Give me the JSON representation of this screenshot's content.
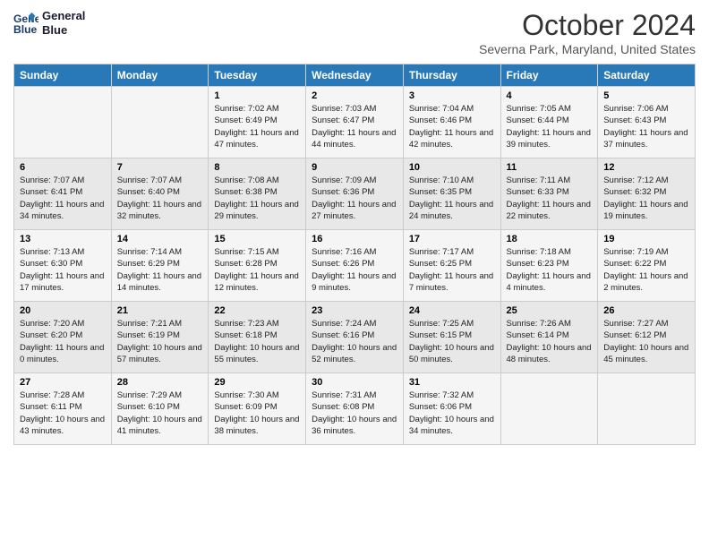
{
  "header": {
    "logo_line1": "General",
    "logo_line2": "Blue",
    "month_year": "October 2024",
    "location": "Severna Park, Maryland, United States"
  },
  "weekdays": [
    "Sunday",
    "Monday",
    "Tuesday",
    "Wednesday",
    "Thursday",
    "Friday",
    "Saturday"
  ],
  "weeks": [
    [
      {
        "day": "",
        "sunrise": "",
        "sunset": "",
        "daylight": ""
      },
      {
        "day": "",
        "sunrise": "",
        "sunset": "",
        "daylight": ""
      },
      {
        "day": "1",
        "sunrise": "Sunrise: 7:02 AM",
        "sunset": "Sunset: 6:49 PM",
        "daylight": "Daylight: 11 hours and 47 minutes."
      },
      {
        "day": "2",
        "sunrise": "Sunrise: 7:03 AM",
        "sunset": "Sunset: 6:47 PM",
        "daylight": "Daylight: 11 hours and 44 minutes."
      },
      {
        "day": "3",
        "sunrise": "Sunrise: 7:04 AM",
        "sunset": "Sunset: 6:46 PM",
        "daylight": "Daylight: 11 hours and 42 minutes."
      },
      {
        "day": "4",
        "sunrise": "Sunrise: 7:05 AM",
        "sunset": "Sunset: 6:44 PM",
        "daylight": "Daylight: 11 hours and 39 minutes."
      },
      {
        "day": "5",
        "sunrise": "Sunrise: 7:06 AM",
        "sunset": "Sunset: 6:43 PM",
        "daylight": "Daylight: 11 hours and 37 minutes."
      }
    ],
    [
      {
        "day": "6",
        "sunrise": "Sunrise: 7:07 AM",
        "sunset": "Sunset: 6:41 PM",
        "daylight": "Daylight: 11 hours and 34 minutes."
      },
      {
        "day": "7",
        "sunrise": "Sunrise: 7:07 AM",
        "sunset": "Sunset: 6:40 PM",
        "daylight": "Daylight: 11 hours and 32 minutes."
      },
      {
        "day": "8",
        "sunrise": "Sunrise: 7:08 AM",
        "sunset": "Sunset: 6:38 PM",
        "daylight": "Daylight: 11 hours and 29 minutes."
      },
      {
        "day": "9",
        "sunrise": "Sunrise: 7:09 AM",
        "sunset": "Sunset: 6:36 PM",
        "daylight": "Daylight: 11 hours and 27 minutes."
      },
      {
        "day": "10",
        "sunrise": "Sunrise: 7:10 AM",
        "sunset": "Sunset: 6:35 PM",
        "daylight": "Daylight: 11 hours and 24 minutes."
      },
      {
        "day": "11",
        "sunrise": "Sunrise: 7:11 AM",
        "sunset": "Sunset: 6:33 PM",
        "daylight": "Daylight: 11 hours and 22 minutes."
      },
      {
        "day": "12",
        "sunrise": "Sunrise: 7:12 AM",
        "sunset": "Sunset: 6:32 PM",
        "daylight": "Daylight: 11 hours and 19 minutes."
      }
    ],
    [
      {
        "day": "13",
        "sunrise": "Sunrise: 7:13 AM",
        "sunset": "Sunset: 6:30 PM",
        "daylight": "Daylight: 11 hours and 17 minutes."
      },
      {
        "day": "14",
        "sunrise": "Sunrise: 7:14 AM",
        "sunset": "Sunset: 6:29 PM",
        "daylight": "Daylight: 11 hours and 14 minutes."
      },
      {
        "day": "15",
        "sunrise": "Sunrise: 7:15 AM",
        "sunset": "Sunset: 6:28 PM",
        "daylight": "Daylight: 11 hours and 12 minutes."
      },
      {
        "day": "16",
        "sunrise": "Sunrise: 7:16 AM",
        "sunset": "Sunset: 6:26 PM",
        "daylight": "Daylight: 11 hours and 9 minutes."
      },
      {
        "day": "17",
        "sunrise": "Sunrise: 7:17 AM",
        "sunset": "Sunset: 6:25 PM",
        "daylight": "Daylight: 11 hours and 7 minutes."
      },
      {
        "day": "18",
        "sunrise": "Sunrise: 7:18 AM",
        "sunset": "Sunset: 6:23 PM",
        "daylight": "Daylight: 11 hours and 4 minutes."
      },
      {
        "day": "19",
        "sunrise": "Sunrise: 7:19 AM",
        "sunset": "Sunset: 6:22 PM",
        "daylight": "Daylight: 11 hours and 2 minutes."
      }
    ],
    [
      {
        "day": "20",
        "sunrise": "Sunrise: 7:20 AM",
        "sunset": "Sunset: 6:20 PM",
        "daylight": "Daylight: 11 hours and 0 minutes."
      },
      {
        "day": "21",
        "sunrise": "Sunrise: 7:21 AM",
        "sunset": "Sunset: 6:19 PM",
        "daylight": "Daylight: 10 hours and 57 minutes."
      },
      {
        "day": "22",
        "sunrise": "Sunrise: 7:23 AM",
        "sunset": "Sunset: 6:18 PM",
        "daylight": "Daylight: 10 hours and 55 minutes."
      },
      {
        "day": "23",
        "sunrise": "Sunrise: 7:24 AM",
        "sunset": "Sunset: 6:16 PM",
        "daylight": "Daylight: 10 hours and 52 minutes."
      },
      {
        "day": "24",
        "sunrise": "Sunrise: 7:25 AM",
        "sunset": "Sunset: 6:15 PM",
        "daylight": "Daylight: 10 hours and 50 minutes."
      },
      {
        "day": "25",
        "sunrise": "Sunrise: 7:26 AM",
        "sunset": "Sunset: 6:14 PM",
        "daylight": "Daylight: 10 hours and 48 minutes."
      },
      {
        "day": "26",
        "sunrise": "Sunrise: 7:27 AM",
        "sunset": "Sunset: 6:12 PM",
        "daylight": "Daylight: 10 hours and 45 minutes."
      }
    ],
    [
      {
        "day": "27",
        "sunrise": "Sunrise: 7:28 AM",
        "sunset": "Sunset: 6:11 PM",
        "daylight": "Daylight: 10 hours and 43 minutes."
      },
      {
        "day": "28",
        "sunrise": "Sunrise: 7:29 AM",
        "sunset": "Sunset: 6:10 PM",
        "daylight": "Daylight: 10 hours and 41 minutes."
      },
      {
        "day": "29",
        "sunrise": "Sunrise: 7:30 AM",
        "sunset": "Sunset: 6:09 PM",
        "daylight": "Daylight: 10 hours and 38 minutes."
      },
      {
        "day": "30",
        "sunrise": "Sunrise: 7:31 AM",
        "sunset": "Sunset: 6:08 PM",
        "daylight": "Daylight: 10 hours and 36 minutes."
      },
      {
        "day": "31",
        "sunrise": "Sunrise: 7:32 AM",
        "sunset": "Sunset: 6:06 PM",
        "daylight": "Daylight: 10 hours and 34 minutes."
      },
      {
        "day": "",
        "sunrise": "",
        "sunset": "",
        "daylight": ""
      },
      {
        "day": "",
        "sunrise": "",
        "sunset": "",
        "daylight": ""
      }
    ]
  ]
}
